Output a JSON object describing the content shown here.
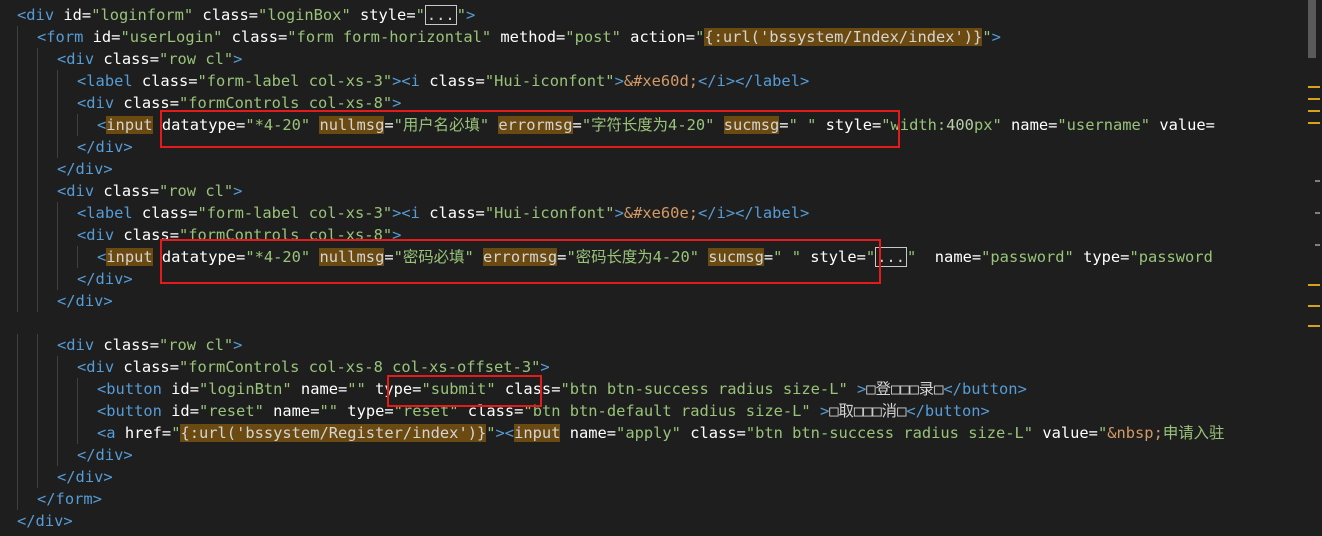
{
  "editor": {
    "lines": [
      [
        {
          "t": "<",
          "c": "tag"
        },
        {
          "t": "div",
          "c": "tag"
        },
        {
          "t": " id",
          "c": "attr"
        },
        {
          "t": "=",
          "c": "eq"
        },
        {
          "t": "\"",
          "c": "str"
        },
        {
          "t": "loginform",
          "c": "str"
        },
        {
          "t": "\"",
          "c": "str"
        },
        {
          "t": " class",
          "c": "attr"
        },
        {
          "t": "=",
          "c": "eq"
        },
        {
          "t": "\"loginBox\"",
          "c": "str"
        },
        {
          "t": " style",
          "c": "attr"
        },
        {
          "t": "=",
          "c": "eq"
        },
        {
          "t": "\"",
          "c": "str"
        },
        {
          "t": "...",
          "c": "fold"
        },
        {
          "t": "\"",
          "c": "str"
        },
        {
          "t": ">",
          "c": "tag"
        }
      ],
      [
        {
          "t": "<",
          "c": "tag"
        },
        {
          "t": "form",
          "c": "tag"
        },
        {
          "t": " id",
          "c": "attr"
        },
        {
          "t": "=",
          "c": "eq"
        },
        {
          "t": "\"userLogin\"",
          "c": "str"
        },
        {
          "t": " class",
          "c": "attr"
        },
        {
          "t": "=",
          "c": "eq"
        },
        {
          "t": "\"form form-horizontal\"",
          "c": "str"
        },
        {
          "t": " method",
          "c": "attr"
        },
        {
          "t": "=",
          "c": "eq"
        },
        {
          "t": "\"post\"",
          "c": "str"
        },
        {
          "t": " action",
          "c": "attr"
        },
        {
          "t": "=",
          "c": "eq"
        },
        {
          "t": "\"",
          "c": "str"
        },
        {
          "t": "{:url('bssystem/Index/index')}",
          "c": "hl"
        },
        {
          "t": "\"",
          "c": "str"
        },
        {
          "t": ">",
          "c": "tag"
        }
      ],
      [
        {
          "t": "<",
          "c": "tag"
        },
        {
          "t": "div",
          "c": "tag"
        },
        {
          "t": " class",
          "c": "attr"
        },
        {
          "t": "=",
          "c": "eq"
        },
        {
          "t": "\"row cl\"",
          "c": "str"
        },
        {
          "t": ">",
          "c": "tag"
        }
      ],
      [
        {
          "t": "<",
          "c": "tag"
        },
        {
          "t": "label",
          "c": "tag"
        },
        {
          "t": " class",
          "c": "attr"
        },
        {
          "t": "=",
          "c": "eq"
        },
        {
          "t": "\"form-label col-xs-3\"",
          "c": "str"
        },
        {
          "t": "><",
          "c": "tag"
        },
        {
          "t": "i",
          "c": "tag"
        },
        {
          "t": " class",
          "c": "attr"
        },
        {
          "t": "=",
          "c": "eq"
        },
        {
          "t": "\"Hui-iconfont\"",
          "c": "str"
        },
        {
          "t": ">",
          "c": "tag"
        },
        {
          "t": "&#xe60d;",
          "c": "ent"
        },
        {
          "t": "</",
          "c": "tag"
        },
        {
          "t": "i",
          "c": "tag"
        },
        {
          "t": "></",
          "c": "tag"
        },
        {
          "t": "label",
          "c": "tag"
        },
        {
          "t": ">",
          "c": "tag"
        }
      ],
      [
        {
          "t": "<",
          "c": "tag"
        },
        {
          "t": "div",
          "c": "tag"
        },
        {
          "t": " class",
          "c": "attr"
        },
        {
          "t": "=",
          "c": "eq"
        },
        {
          "t": "\"formControls col-xs-8\"",
          "c": "str"
        },
        {
          "t": ">",
          "c": "tag"
        }
      ],
      [
        {
          "t": "<",
          "c": "tag"
        },
        {
          "t": "input",
          "c": "hl"
        },
        {
          "t": " datatype",
          "c": "attr"
        },
        {
          "t": "=",
          "c": "eq"
        },
        {
          "t": "\"*4-20\"",
          "c": "str"
        },
        {
          "t": " ",
          "c": "txt"
        },
        {
          "t": "nullmsg",
          "c": "hl"
        },
        {
          "t": "=",
          "c": "eq"
        },
        {
          "t": "\"用户名必填\"",
          "c": "str"
        },
        {
          "t": " ",
          "c": "txt"
        },
        {
          "t": "errormsg",
          "c": "hl"
        },
        {
          "t": "=",
          "c": "eq"
        },
        {
          "t": "\"字符长度为4-20\"",
          "c": "str"
        },
        {
          "t": " ",
          "c": "txt"
        },
        {
          "t": "sucmsg",
          "c": "hl"
        },
        {
          "t": "=",
          "c": "eq"
        },
        {
          "t": "\" \"",
          "c": "str"
        },
        {
          "t": " style",
          "c": "attr"
        },
        {
          "t": "=",
          "c": "eq"
        },
        {
          "t": "\"width:",
          "c": "str"
        },
        {
          "t": "400",
          "c": "num"
        },
        {
          "t": "px\"",
          "c": "str"
        },
        {
          "t": " name",
          "c": "attr"
        },
        {
          "t": "=",
          "c": "eq"
        },
        {
          "t": "\"username\"",
          "c": "str"
        },
        {
          "t": " value",
          "c": "attr"
        },
        {
          "t": "=",
          "c": "eq"
        }
      ],
      [
        {
          "t": "</",
          "c": "tag"
        },
        {
          "t": "div",
          "c": "tag"
        },
        {
          "t": ">",
          "c": "tag"
        }
      ],
      [
        {
          "t": "</",
          "c": "tag"
        },
        {
          "t": "div",
          "c": "tag"
        },
        {
          "t": ">",
          "c": "tag"
        }
      ],
      [
        {
          "t": "<",
          "c": "tag"
        },
        {
          "t": "div",
          "c": "tag"
        },
        {
          "t": " class",
          "c": "attr"
        },
        {
          "t": "=",
          "c": "eq"
        },
        {
          "t": "\"row cl\"",
          "c": "str"
        },
        {
          "t": ">",
          "c": "tag"
        }
      ],
      [
        {
          "t": "<",
          "c": "tag"
        },
        {
          "t": "label",
          "c": "tag"
        },
        {
          "t": " class",
          "c": "attr"
        },
        {
          "t": "=",
          "c": "eq"
        },
        {
          "t": "\"form-label col-xs-3\"",
          "c": "str"
        },
        {
          "t": "><",
          "c": "tag"
        },
        {
          "t": "i",
          "c": "tag"
        },
        {
          "t": " class",
          "c": "attr"
        },
        {
          "t": "=",
          "c": "eq"
        },
        {
          "t": "\"Hui-iconfont\"",
          "c": "str"
        },
        {
          "t": ">",
          "c": "tag"
        },
        {
          "t": "&#xe60e;",
          "c": "ent"
        },
        {
          "t": "</",
          "c": "tag"
        },
        {
          "t": "i",
          "c": "tag"
        },
        {
          "t": "></",
          "c": "tag"
        },
        {
          "t": "label",
          "c": "tag"
        },
        {
          "t": ">",
          "c": "tag"
        }
      ],
      [
        {
          "t": "<",
          "c": "tag"
        },
        {
          "t": "div",
          "c": "tag"
        },
        {
          "t": " class",
          "c": "attr"
        },
        {
          "t": "=",
          "c": "eq"
        },
        {
          "t": "\"formControls col-xs-8\"",
          "c": "str"
        },
        {
          "t": ">",
          "c": "tag"
        }
      ],
      [
        {
          "t": "<",
          "c": "tag"
        },
        {
          "t": "input",
          "c": "hl"
        },
        {
          "t": " datatype",
          "c": "attr"
        },
        {
          "t": "=",
          "c": "eq"
        },
        {
          "t": "\"*4-20\"",
          "c": "str"
        },
        {
          "t": " ",
          "c": "txt"
        },
        {
          "t": "nullmsg",
          "c": "hl"
        },
        {
          "t": "=",
          "c": "eq"
        },
        {
          "t": "\"密码必填\"",
          "c": "str"
        },
        {
          "t": " ",
          "c": "txt"
        },
        {
          "t": "errormsg",
          "c": "hl"
        },
        {
          "t": "=",
          "c": "eq"
        },
        {
          "t": "\"密码长度为4-20\"",
          "c": "str"
        },
        {
          "t": " ",
          "c": "txt"
        },
        {
          "t": "sucmsg",
          "c": "hl"
        },
        {
          "t": "=",
          "c": "eq"
        },
        {
          "t": "\" \"",
          "c": "str"
        },
        {
          "t": " style",
          "c": "attr"
        },
        {
          "t": "=",
          "c": "eq"
        },
        {
          "t": "\"",
          "c": "str"
        },
        {
          "t": "...",
          "c": "fold"
        },
        {
          "t": "\"",
          "c": "str"
        },
        {
          "t": "  name",
          "c": "attr"
        },
        {
          "t": "=",
          "c": "eq"
        },
        {
          "t": "\"password\"",
          "c": "str"
        },
        {
          "t": " type",
          "c": "attr"
        },
        {
          "t": "=",
          "c": "eq"
        },
        {
          "t": "\"password",
          "c": "str"
        }
      ],
      [
        {
          "t": "</",
          "c": "tag"
        },
        {
          "t": "div",
          "c": "tag"
        },
        {
          "t": ">",
          "c": "tag"
        }
      ],
      [
        {
          "t": "</",
          "c": "tag"
        },
        {
          "t": "div",
          "c": "tag"
        },
        {
          "t": ">",
          "c": "tag"
        }
      ],
      [],
      [
        {
          "t": "<",
          "c": "tag"
        },
        {
          "t": "div",
          "c": "tag"
        },
        {
          "t": " class",
          "c": "attr"
        },
        {
          "t": "=",
          "c": "eq"
        },
        {
          "t": "\"row cl\"",
          "c": "str"
        },
        {
          "t": ">",
          "c": "tag"
        }
      ],
      [
        {
          "t": "<",
          "c": "tag"
        },
        {
          "t": "div",
          "c": "tag"
        },
        {
          "t": " class",
          "c": "attr"
        },
        {
          "t": "=",
          "c": "eq"
        },
        {
          "t": "\"formControls col-xs-8 col-xs-offset-3\"",
          "c": "str"
        },
        {
          "t": ">",
          "c": "tag"
        }
      ],
      [
        {
          "t": "<",
          "c": "tag"
        },
        {
          "t": "button",
          "c": "tag"
        },
        {
          "t": " id",
          "c": "attr"
        },
        {
          "t": "=",
          "c": "eq"
        },
        {
          "t": "\"loginBtn\"",
          "c": "str"
        },
        {
          "t": " name",
          "c": "attr"
        },
        {
          "t": "=",
          "c": "eq"
        },
        {
          "t": "\"\"",
          "c": "str"
        },
        {
          "t": " type",
          "c": "attr"
        },
        {
          "t": "=",
          "c": "eq"
        },
        {
          "t": "\"submit\"",
          "c": "str"
        },
        {
          "t": " class",
          "c": "attr"
        },
        {
          "t": "=",
          "c": "eq"
        },
        {
          "t": "\"btn btn-success radius size-L\"",
          "c": "str"
        },
        {
          "t": " >",
          "c": "tag"
        },
        {
          "t": "□登□□□录□",
          "c": "txt"
        },
        {
          "t": "</",
          "c": "tag"
        },
        {
          "t": "button",
          "c": "tag"
        },
        {
          "t": ">",
          "c": "tag"
        }
      ],
      [
        {
          "t": "<",
          "c": "tag"
        },
        {
          "t": "button",
          "c": "tag"
        },
        {
          "t": " id",
          "c": "attr"
        },
        {
          "t": "=",
          "c": "eq"
        },
        {
          "t": "\"reset\"",
          "c": "str"
        },
        {
          "t": " name",
          "c": "attr"
        },
        {
          "t": "=",
          "c": "eq"
        },
        {
          "t": "\"\"",
          "c": "str"
        },
        {
          "t": " type",
          "c": "attr"
        },
        {
          "t": "=",
          "c": "eq"
        },
        {
          "t": "\"reset\"",
          "c": "str"
        },
        {
          "t": " class",
          "c": "attr"
        },
        {
          "t": "=",
          "c": "eq"
        },
        {
          "t": "\"btn btn-default radius size-L\"",
          "c": "str"
        },
        {
          "t": " >",
          "c": "tag"
        },
        {
          "t": "□取□□□消□",
          "c": "txt"
        },
        {
          "t": "</",
          "c": "tag"
        },
        {
          "t": "button",
          "c": "tag"
        },
        {
          "t": ">",
          "c": "tag"
        }
      ],
      [
        {
          "t": "<",
          "c": "tag"
        },
        {
          "t": "a",
          "c": "tag"
        },
        {
          "t": " href",
          "c": "attr"
        },
        {
          "t": "=",
          "c": "eq"
        },
        {
          "t": "\"",
          "c": "str"
        },
        {
          "t": "{:url('bssystem/Register/index')}",
          "c": "hl"
        },
        {
          "t": "\"",
          "c": "str"
        },
        {
          "t": "><",
          "c": "tag"
        },
        {
          "t": "input",
          "c": "hl"
        },
        {
          "t": " name",
          "c": "attr"
        },
        {
          "t": "=",
          "c": "eq"
        },
        {
          "t": "\"apply\"",
          "c": "str"
        },
        {
          "t": " class",
          "c": "attr"
        },
        {
          "t": "=",
          "c": "eq"
        },
        {
          "t": "\"btn btn-success radius size-L\"",
          "c": "str"
        },
        {
          "t": " value",
          "c": "attr"
        },
        {
          "t": "=",
          "c": "eq"
        },
        {
          "t": "\"",
          "c": "str"
        },
        {
          "t": "&nbsp;",
          "c": "ent"
        },
        {
          "t": "申请入驻",
          "c": "str"
        }
      ],
      [
        {
          "t": "</",
          "c": "tag"
        },
        {
          "t": "div",
          "c": "tag"
        },
        {
          "t": ">",
          "c": "tag"
        }
      ],
      [
        {
          "t": "</",
          "c": "tag"
        },
        {
          "t": "div",
          "c": "tag"
        },
        {
          "t": ">",
          "c": "tag"
        }
      ],
      [
        {
          "t": "</",
          "c": "tag"
        },
        {
          "t": "form",
          "c": "tag"
        },
        {
          "t": ">",
          "c": "tag"
        }
      ],
      [
        {
          "t": "</",
          "c": "tag"
        },
        {
          "t": "div",
          "c": "tag"
        },
        {
          "t": ">",
          "c": "tag"
        }
      ]
    ]
  },
  "colors": {
    "background": "#1e1e1e",
    "tag": "#569cd6",
    "string": "#98c379",
    "highlight": "#6b4a12",
    "annotation_box": "#e51b1b"
  }
}
